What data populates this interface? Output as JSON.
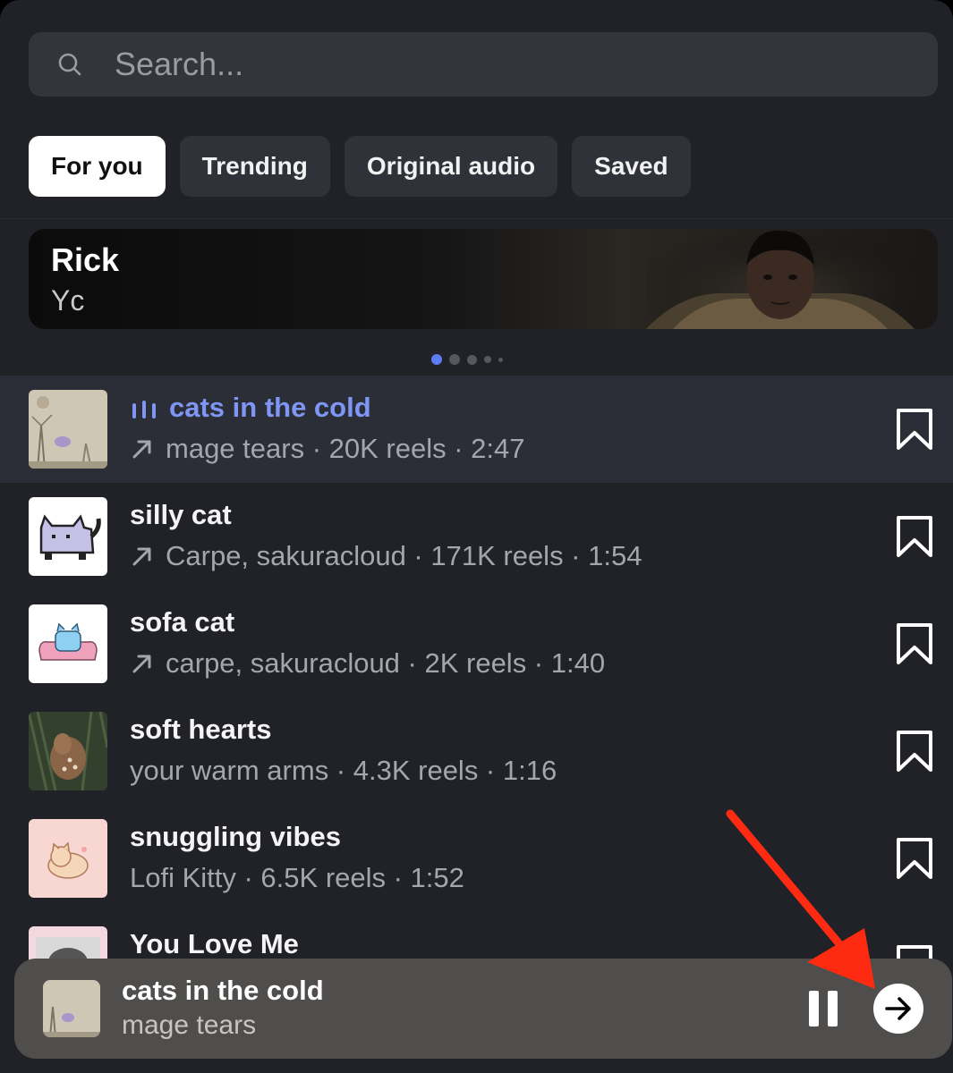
{
  "search": {
    "placeholder": "Search..."
  },
  "tabs": [
    {
      "label": "For you",
      "active": true
    },
    {
      "label": "Trending",
      "active": false
    },
    {
      "label": "Original audio",
      "active": false
    },
    {
      "label": "Saved",
      "active": false
    }
  ],
  "banner": {
    "title": "Rick",
    "subtitle": "Yc",
    "page_count": 5,
    "current_page": 1
  },
  "tracks": [
    {
      "name": "cats in the cold",
      "meta": "mage tears · 20K reels · 2:47",
      "trending": true,
      "playing": true
    },
    {
      "name": "silly cat",
      "meta": "Carpe, sakuracloud · 171K reels · 1:54",
      "trending": true,
      "playing": false
    },
    {
      "name": "sofa cat",
      "meta": "carpe, sakuracloud · 2K reels · 1:40",
      "trending": true,
      "playing": false
    },
    {
      "name": "soft hearts",
      "meta": "your warm arms · 4.3K reels · 1:16",
      "trending": false,
      "playing": false
    },
    {
      "name": "snuggling vibes",
      "meta": "Lofi Kitty · 6.5K reels · 1:52",
      "trending": false,
      "playing": false
    },
    {
      "name": "You Love Me",
      "meta": "",
      "trending": false,
      "playing": false
    }
  ],
  "player": {
    "title": "cats in the cold",
    "artist": "mage tears"
  },
  "colors": {
    "accent": "#7f96f5",
    "annotation": "#ff2a12"
  }
}
